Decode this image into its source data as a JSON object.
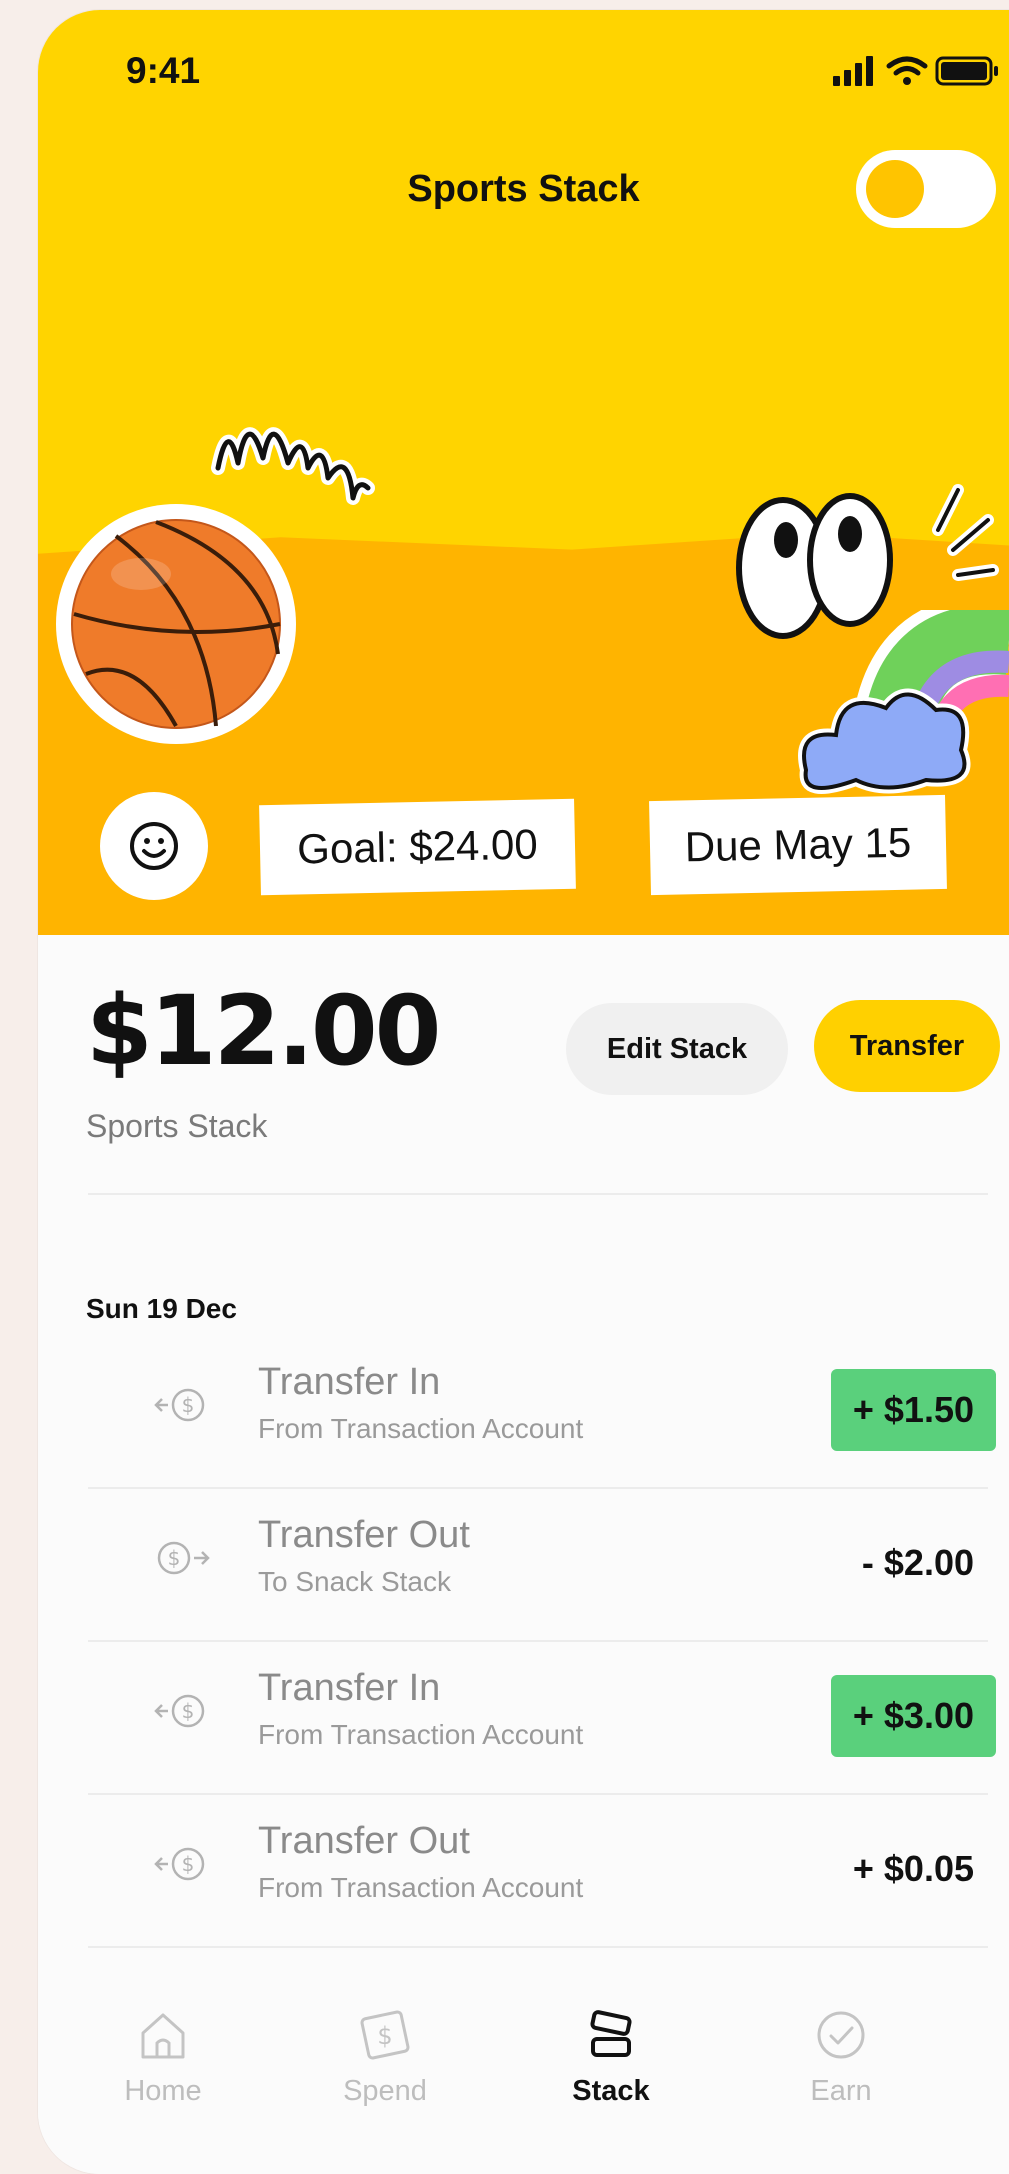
{
  "status": {
    "time": "9:41"
  },
  "header": {
    "title": "Sports Stack"
  },
  "hero": {
    "goal": "Goal: $24.00",
    "due": "Due May 15",
    "accent": "#ffd400"
  },
  "balance": {
    "amount": "$12.00",
    "label": "Sports Stack",
    "edit_label": "Edit Stack",
    "transfer_label": "Transfer"
  },
  "transactions": {
    "date": "Sun 19 Dec",
    "items": [
      {
        "name": "Transfer In",
        "sub": "From Transaction Account",
        "amount": "+ $1.50",
        "highlight": true,
        "icon": "transfer-in-icon"
      },
      {
        "name": "Transfer Out",
        "sub": "To Snack Stack",
        "amount": "- $2.00",
        "highlight": false,
        "icon": "transfer-out-icon"
      },
      {
        "name": "Transfer In",
        "sub": "From Transaction Account",
        "amount": "+ $3.00",
        "highlight": true,
        "icon": "transfer-in-icon"
      },
      {
        "name": "Transfer Out",
        "sub": "From Transaction Account",
        "amount": "+ $0.05",
        "highlight": false,
        "icon": "transfer-in-icon"
      }
    ]
  },
  "tabs": [
    {
      "label": "Home",
      "icon": "home-icon",
      "active": false
    },
    {
      "label": "Spend",
      "icon": "dollar-bill-icon",
      "active": false
    },
    {
      "label": "Stack",
      "icon": "stack-icon",
      "active": true
    },
    {
      "label": "Earn",
      "icon": "check-circle-icon",
      "active": false
    }
  ],
  "colors": {
    "positive": "#5ad07c",
    "brand_yellow": "#ffd000",
    "orange": "#ffb400"
  }
}
